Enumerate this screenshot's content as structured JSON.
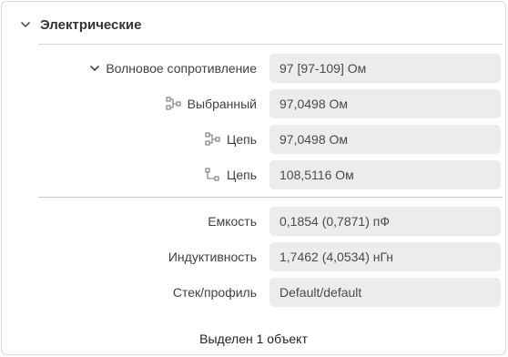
{
  "section": {
    "title": "Электрические"
  },
  "rows": [
    {
      "label": "Волновое сопротивление",
      "value": "97 [97-109] Ом",
      "icon": "chevron-down-icon"
    },
    {
      "label": "Выбранный",
      "value": "97,0498 Ом",
      "icon": "net-tree-icon"
    },
    {
      "label": "Цепь",
      "value": "97,0498 Ом",
      "icon": "net-tree-icon"
    },
    {
      "label": "Цепь",
      "value": "108,5116 Ом",
      "icon": "net-link-icon"
    },
    {
      "label": "Емкость",
      "value": "0,1854 (0,7871) пФ"
    },
    {
      "label": "Индуктивность",
      "value": "1,7462 (4,0534) нГн"
    },
    {
      "label": "Стек/профиль",
      "value": "Default/default"
    }
  ],
  "footer": {
    "status": "Выделен 1 объект"
  }
}
